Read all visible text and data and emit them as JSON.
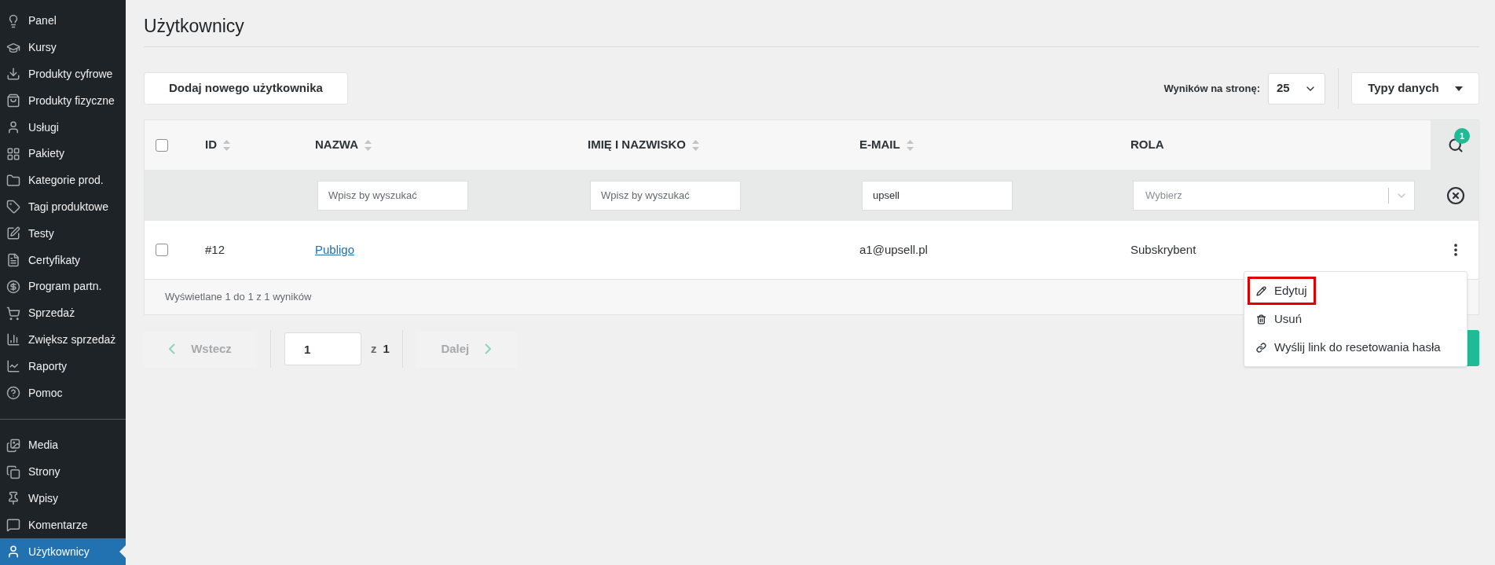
{
  "sidebar": {
    "items": [
      {
        "label": "Panel",
        "selected": false
      },
      {
        "label": "Kursy",
        "selected": false
      },
      {
        "label": "Produkty cyfrowe",
        "selected": false
      },
      {
        "label": "Produkty fizyczne",
        "selected": false
      },
      {
        "label": "Usługi",
        "selected": false
      },
      {
        "label": "Pakiety",
        "selected": false
      },
      {
        "label": "Kategorie prod.",
        "selected": false
      },
      {
        "label": "Tagi produktowe",
        "selected": false
      },
      {
        "label": "Testy",
        "selected": false
      },
      {
        "label": "Certyfikaty",
        "selected": false
      },
      {
        "label": "Program partn.",
        "selected": false
      },
      {
        "label": "Sprzedaż",
        "selected": false
      },
      {
        "label": "Zwiększ sprzedaż",
        "selected": false
      },
      {
        "label": "Raporty",
        "selected": false
      },
      {
        "label": "Pomoc",
        "selected": false
      }
    ],
    "secondary_items": [
      {
        "label": "Media",
        "selected": false
      },
      {
        "label": "Strony",
        "selected": false
      },
      {
        "label": "Wpisy",
        "selected": false
      },
      {
        "label": "Komentarze",
        "selected": false
      },
      {
        "label": "Użytkownicy",
        "selected": true
      }
    ]
  },
  "page": {
    "title": "Użytkownicy"
  },
  "toolbar": {
    "add_button": "Dodaj nowego użytkownika",
    "per_page_label": "Wyników na stronę:",
    "per_page_value": "25",
    "data_types_button": "Typy danych"
  },
  "table": {
    "select_all_checked": false,
    "columns": [
      {
        "label": "ID",
        "sortable": true
      },
      {
        "label": "NAZWA",
        "sortable": true
      },
      {
        "label": "IMIĘ I NAZWISKO",
        "sortable": true
      },
      {
        "label": "E-MAIL",
        "sortable": true
      },
      {
        "label": "ROLA",
        "sortable": false
      }
    ],
    "search_badge": "1",
    "filters": [
      {
        "kind": "none"
      },
      {
        "kind": "text",
        "placeholder": "Wpisz by wyszukać"
      },
      {
        "kind": "text",
        "placeholder": "Wpisz by wyszukać"
      },
      {
        "kind": "text",
        "value": "upsell"
      },
      {
        "kind": "select",
        "placeholder": "Wybierz"
      }
    ],
    "rows": [
      {
        "checked": false,
        "id": "#12",
        "name": "Publigo",
        "email": "a1@upsell.pl",
        "role": "Subskrybent"
      }
    ],
    "footer": "Wyświetlane 1 do 1 z 1 wyników"
  },
  "row_menu": {
    "items": [
      {
        "label": "Edytuj",
        "selected": true
      },
      {
        "label": "Usuń",
        "selected": false
      },
      {
        "label": "Wyślij link do resetowania hasła",
        "selected": false
      }
    ]
  },
  "pagination": {
    "prev": {
      "label": "Wstecz",
      "disabled": true
    },
    "page": "1",
    "of_label": "z",
    "total": "1",
    "next": {
      "label": "Dalej",
      "disabled": true
    }
  }
}
